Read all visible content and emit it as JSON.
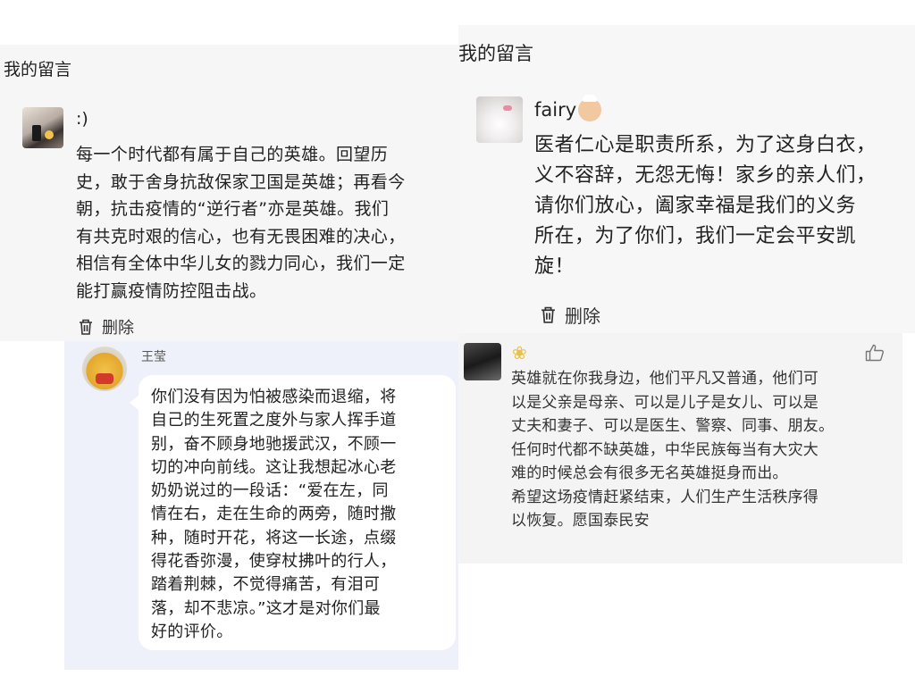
{
  "panel1": {
    "header": "我的留言",
    "name": ":)",
    "lines": [
      "每一个时代都有属于自己的英雄。回望历",
      "史，敢于舍身抗敌保家卫国是英雄；再看今",
      "朝，抗击疫情的“逆行者”亦是英雄。我们",
      "有共克时艰的信心，也有无畏困难的决心，",
      "相信有全体中华儿女的戮力同心，我们一定",
      "能打赢疫情防控阻击战。"
    ],
    "delete_label": "删除"
  },
  "panel2": {
    "header": "我的留言",
    "name": "fairy",
    "lines": [
      "医者仁心是职责所系，为了这身白衣，",
      "义不容辞，无怨无悔！家乡的亲人们，",
      "请你们放心，阖家幸福是我们的义务",
      "所在，为了你们，我们一定会平安凯",
      "旋！"
    ],
    "delete_label": "删除"
  },
  "panel3": {
    "name": "王莹",
    "lines": [
      "你们没有因为怕被感染而退缩，将",
      "自己的生死置之度外与家人挥手道",
      "别，奋不顾身地驰援武汉，不顾一",
      "切的冲向前线。这让我想起冰心老",
      "奶奶说过的一段话：“爱在左，同",
      "情在右，走在生命的两旁，随时撒",
      "种，随时开花，将这一长途，点缀",
      "得花香弥漫，使穿杖拂叶的行人，",
      "踏着荆棘，不觉得痛苦，有泪可",
      "落，却不悲凉。”这才是对你们最",
      "好的评价。"
    ]
  },
  "panel4": {
    "lines": [
      "英雄就在你我身边，他们平凡又普通，他们可",
      "以是父亲是母亲、可以是儿子是女儿、可以是",
      "丈夫和妻子、可以是医生、警察、同事、朋友。",
      "任何时代都不缺英雄，中华民族每当有大灾大",
      "难的时候总会有很多无名英雄挺身而出。",
      "希望这场疫情赶紧结束，人们生产生活秩序得",
      "以恢复。愿国泰民安"
    ]
  }
}
